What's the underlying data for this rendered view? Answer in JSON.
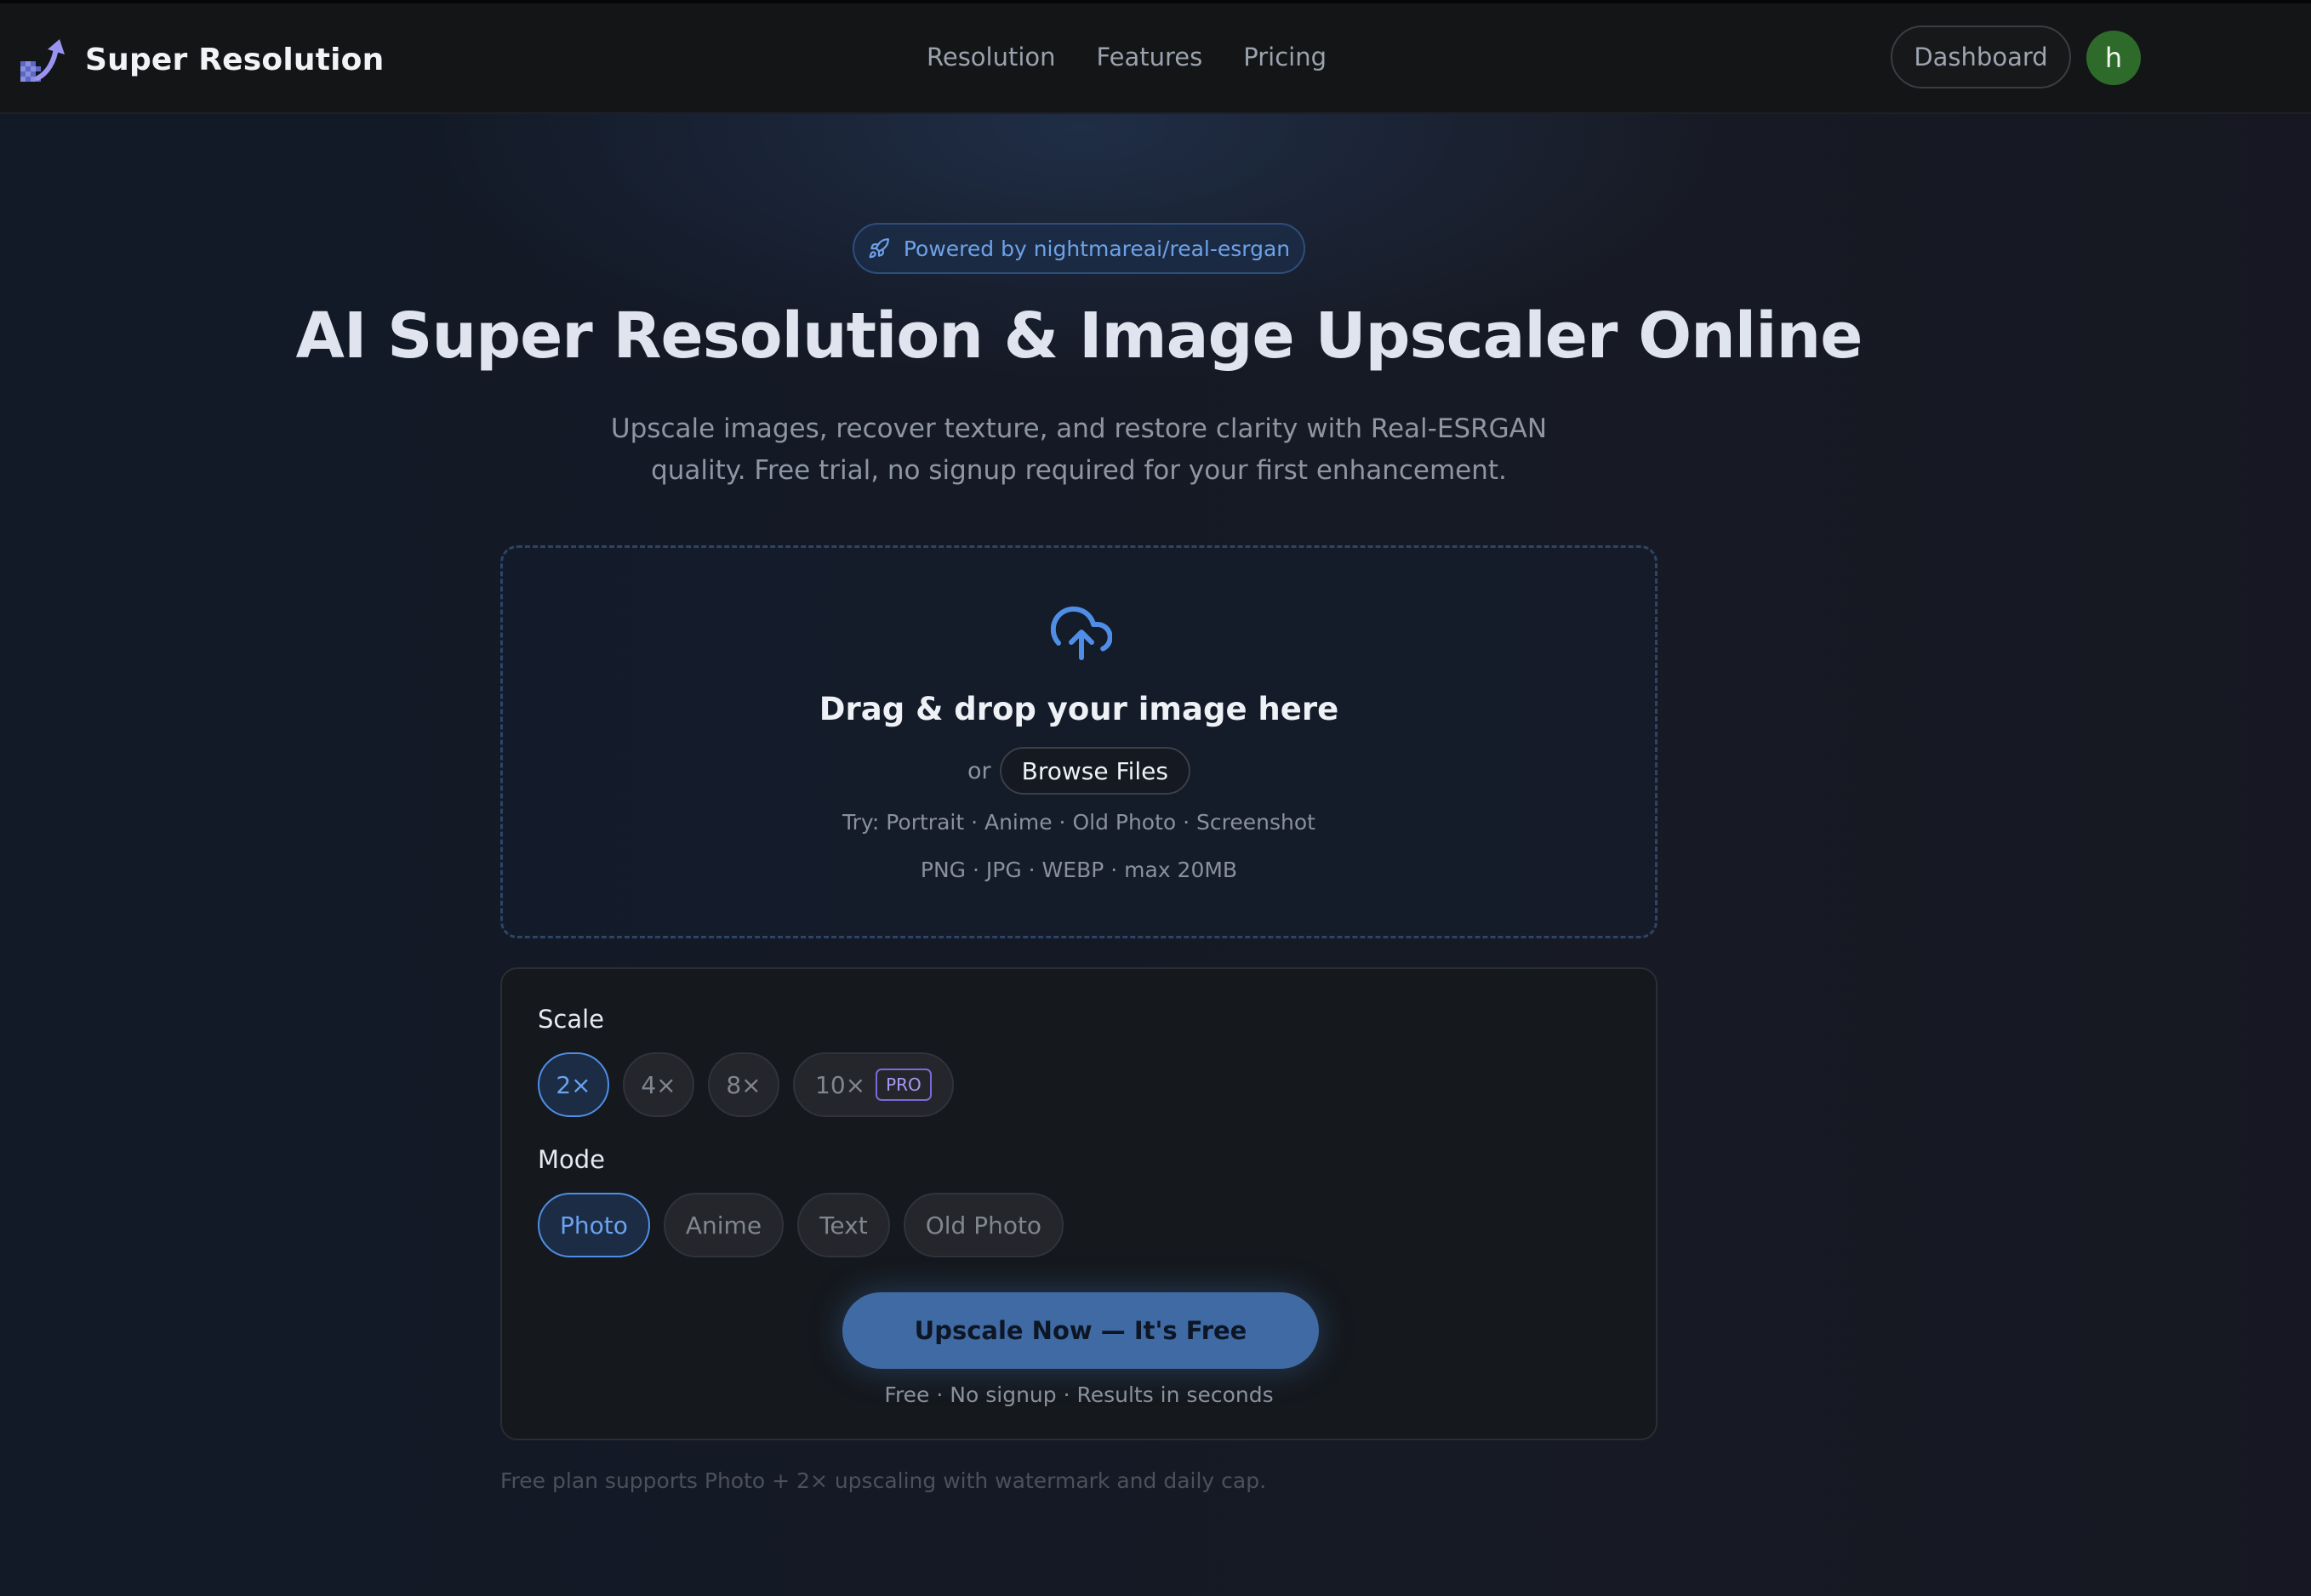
{
  "brand": {
    "name": "Super Resolution",
    "logo_icon": "upscale-arrow-icon"
  },
  "nav": {
    "items": [
      {
        "label": "Resolution"
      },
      {
        "label": "Features"
      },
      {
        "label": "Pricing"
      }
    ],
    "dashboard_label": "Dashboard",
    "avatar_initial": "h"
  },
  "hero": {
    "badge_icon": "rocket-icon",
    "badge_text": "Powered by nightmareai/real-esrgan",
    "title": "AI Super Resolution & Image Upscaler Online",
    "subtitle_line1": "Upscale images, recover texture, and restore clarity with Real-ESRGAN",
    "subtitle_line2": "quality. Free trial, no signup required for your first enhancement."
  },
  "dropzone": {
    "icon": "cloud-upload-icon",
    "title": "Drag & drop your image here",
    "or_text": "or",
    "browse_label": "Browse Files",
    "try_text": "Try: Portrait · Anime · Old Photo · Screenshot",
    "formats_text": "PNG · JPG · WEBP · max 20MB"
  },
  "options": {
    "scale_label": "Scale",
    "scales": [
      {
        "label": "2×",
        "selected": true
      },
      {
        "label": "4×",
        "selected": false
      },
      {
        "label": "8×",
        "selected": false
      },
      {
        "label": "10×",
        "selected": false,
        "tag": "PRO"
      }
    ],
    "mode_label": "Mode",
    "modes": [
      {
        "label": "Photo",
        "selected": true
      },
      {
        "label": "Anime",
        "selected": false
      },
      {
        "label": "Text",
        "selected": false
      },
      {
        "label": "Old Photo",
        "selected": false
      }
    ],
    "cta_label": "Upscale Now — It's Free",
    "cta_note": "Free · No signup · Results in seconds"
  },
  "footnote": "Free plan supports Photo + 2× upscaling with watermark and daily cap.",
  "colors": {
    "accent": "#4f8ee6",
    "cta": "#3f6aa4",
    "pro": "#7c6ad8",
    "avatar": "#2e6b2b"
  }
}
